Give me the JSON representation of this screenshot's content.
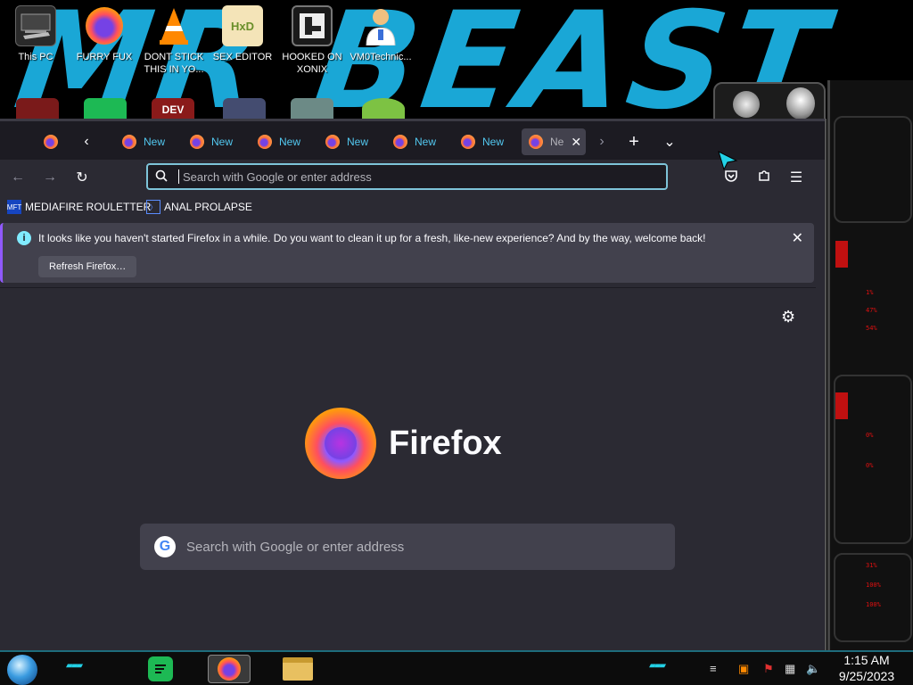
{
  "desktop": {
    "icons": [
      {
        "label": "This PC"
      },
      {
        "label": "FURRY FUX"
      },
      {
        "label": "DONT STICK THIS IN YO..."
      },
      {
        "label": "SEX EDITOR"
      },
      {
        "label": "HOOKED ON XONIX"
      },
      {
        "label": "VM0Technic..."
      }
    ],
    "dev_label": "DEV",
    "wallpaper_text": "MR BEAST"
  },
  "firefox": {
    "tabs": [
      {
        "title": "New"
      },
      {
        "title": "New"
      },
      {
        "title": "New"
      },
      {
        "title": "New"
      },
      {
        "title": "New"
      },
      {
        "title": "New"
      },
      {
        "title": "Ne"
      }
    ],
    "url_placeholder": "Search with Google or enter address",
    "bookmarks": [
      {
        "label": "MEDIAFIRE ROULETTER",
        "icon": "mediafire-icon"
      },
      {
        "label": "ANAL PROLAPSE",
        "icon": "bookmark-icon"
      }
    ],
    "notice": {
      "message": "It looks like you haven't started Firefox in a while. Do you want to clean it up for a fresh, like-new experience? And by the way, welcome back!",
      "button": "Refresh Firefox…"
    },
    "newtab": {
      "brand": "Firefox",
      "search_placeholder": "Search with Google or enter address",
      "google_letter": "G"
    }
  },
  "gadget": {
    "readouts": [
      "1%",
      "47%",
      "54%",
      "0%",
      "0%",
      "31%",
      "100%",
      "100%"
    ]
  },
  "taskbar": {
    "time": "1:15 AM",
    "date": "9/25/2023"
  },
  "colors": {
    "wallpaper_accent": "#1aa7d6",
    "firefox_bg": "#2b2a33",
    "tabbar_bg": "#1c1b22",
    "urlbar_focus": "#7ec4d9",
    "tab_link_text": "#52c8f0",
    "notice_accent": "#9059ff"
  }
}
